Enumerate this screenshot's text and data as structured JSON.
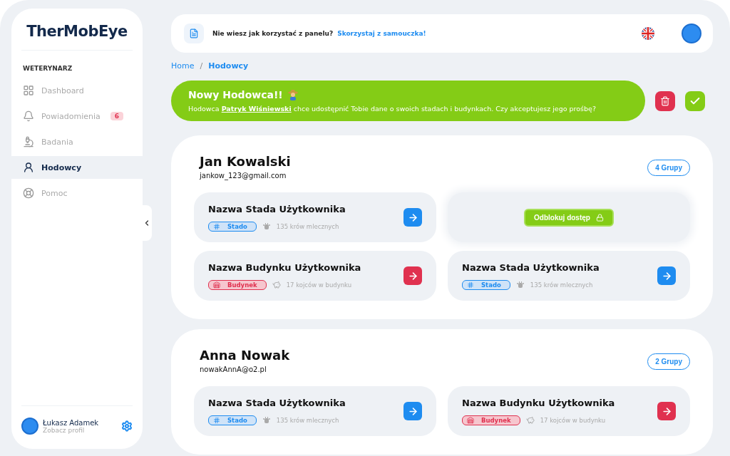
{
  "sidebar": {
    "logo": "TherMobEye",
    "section": "WETERYNARZ",
    "items": [
      {
        "kind": "dashboard",
        "label": "Dashboard",
        "selected": false
      },
      {
        "kind": "notifications",
        "label": "Powiadomienia",
        "badge": "6",
        "selected": false
      },
      {
        "kind": "research",
        "label": "Badania",
        "selected": false
      },
      {
        "kind": "breeders",
        "label": "Hodowcy",
        "selected": true
      },
      {
        "kind": "help",
        "label": "Pomoc",
        "selected": false
      }
    ],
    "user": {
      "name": "Łukasz Adamek",
      "link": "Zobacz profil"
    }
  },
  "topbar": {
    "hint": "Nie wiesz jak korzystać z panelu?",
    "link": "Skorzystaj z samouczka!"
  },
  "breadcrumb_separator": "/",
  "breadcrumbs": [
    {
      "label": "Home",
      "selected": false
    },
    {
      "label": "Hodowcy",
      "selected": true
    }
  ],
  "notification": {
    "title": "Nowy Hodowca!!",
    "text_before": "Hodowca",
    "link": "Patryk Wiśniewski",
    "text_after": "chce udostępnić Tobie dane o swoich stadach i budynkach. Czy akceptujesz jego prośbę?"
  },
  "breeders": [
    {
      "name": "Jan Kowalski",
      "email": "jankow_123@gmail.com",
      "groups": "4 Grupy",
      "tiles": [
        {
          "kind": "herd",
          "title": "Nazwa Stada Użytkownika",
          "tag": "Stado",
          "count": "135 krów mlecznych"
        },
        {
          "kind": "locked",
          "button": "Odblokuj dostęp"
        },
        {
          "kind": "building",
          "title": "Nazwa Budynku Użytkownika",
          "tag": "Budynek",
          "count": "17 kojców w budynku"
        },
        {
          "kind": "herd",
          "title": "Nazwa Stada Użytkownika",
          "tag": "Stado",
          "count": "135 krów mlecznych"
        }
      ]
    },
    {
      "name": "Anna Nowak",
      "email": "nowakAnnA@o2.pl",
      "groups": "2 Grupy",
      "tiles": [
        {
          "kind": "herd",
          "title": "Nazwa Stada Użytkownika",
          "tag": "Stado",
          "count": "135 krów mlecznych"
        },
        {
          "kind": "building",
          "title": "Nazwa Budynku Użytkownika",
          "tag": "Budynek",
          "count": "17 kojców w budynku"
        }
      ]
    }
  ]
}
